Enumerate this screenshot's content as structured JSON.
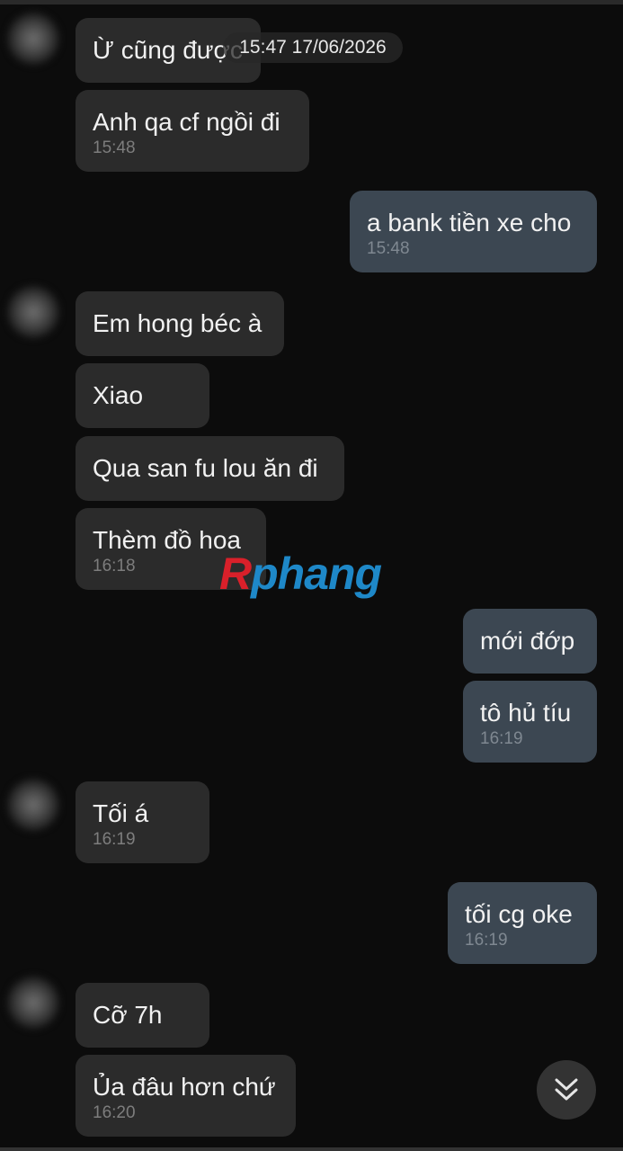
{
  "date_chip": "15:47 17/06/2026",
  "watermark": {
    "first_letter": "R",
    "rest": "phang"
  },
  "messages": [
    {
      "text": "Ừ cũng được",
      "time": ""
    },
    {
      "text": "Anh qa cf ngồi đi",
      "time": "15:48"
    },
    {
      "text": "a bank tiền xe cho",
      "time": "15:48"
    },
    {
      "text": "Em hong béc à",
      "time": ""
    },
    {
      "text": "Xiao",
      "time": ""
    },
    {
      "text": "Qua san fu lou ăn đi",
      "time": ""
    },
    {
      "text": "Thèm đồ hoa",
      "time": "16:18"
    },
    {
      "text": "mới đớp",
      "time": ""
    },
    {
      "text": "tô hủ tíu",
      "time": "16:19"
    },
    {
      "text": "Tối á",
      "time": "16:19"
    },
    {
      "text": "tối cg oke",
      "time": "16:19"
    },
    {
      "text": "Cỡ 7h",
      "time": ""
    },
    {
      "text": "Ủa đâu hơn chứ",
      "time": "16:20"
    }
  ],
  "icons": {
    "avatar": "contact-avatar-blurred",
    "scroll_down": "double-chevron-down-icon"
  },
  "colors": {
    "background": "#0c0c0c",
    "incoming_bubble": "#2b2b2b",
    "outgoing_bubble": "#3c4752",
    "timestamp": "#7f8891"
  }
}
